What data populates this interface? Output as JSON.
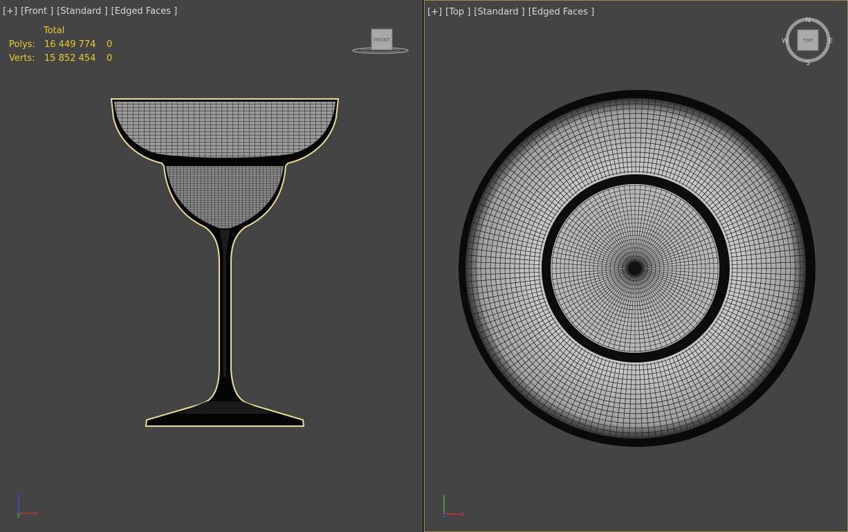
{
  "viewports": {
    "front": {
      "menu_label": "[+]",
      "view_label": "[Front ]",
      "shading_label": "[Standard ]",
      "display_label": "[Edged Faces ]",
      "viewcube_label": "FRONT"
    },
    "top": {
      "menu_label": "[+]",
      "view_label": "[Top ]",
      "shading_label": "[Standard ]",
      "display_label": "[Edged Faces ]",
      "viewcube_label": "TOP",
      "compass": {
        "n": "N",
        "s": "S",
        "e": "E",
        "w": "W"
      }
    }
  },
  "stats": {
    "header": "Total",
    "polys_label": "Polys:",
    "polys_total": "16 449 774",
    "polys_selected": "0",
    "verts_label": "Verts:",
    "verts_total": "15 852 454",
    "verts_selected": "0"
  },
  "axes": {
    "x": "x",
    "y": "y",
    "z": "z"
  },
  "colors": {
    "viewport_bg": "#444444",
    "selection": "#f0e08c",
    "stats_text": "#e8cd2c",
    "active_border": "#9c8c4c",
    "axis_x": "#c83232",
    "axis_y": "#3cb43c",
    "axis_z": "#3c50dc"
  }
}
